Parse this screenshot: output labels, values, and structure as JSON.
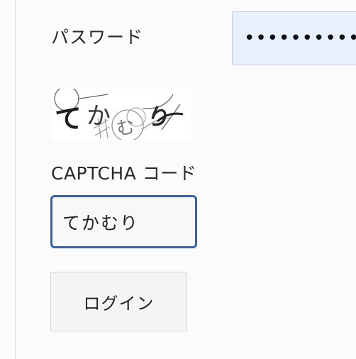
{
  "password": {
    "label": "パスワード",
    "value": "••••••••••"
  },
  "captcha": {
    "image_text": "てかむり",
    "label": "CAPTCHA コード",
    "input_value": "てかむり"
  },
  "login": {
    "button_label": "ログイン"
  }
}
